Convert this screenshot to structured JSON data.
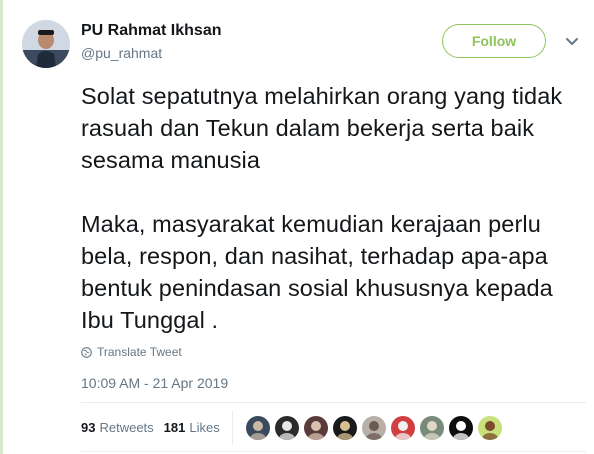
{
  "user": {
    "display_name": "PU Rahmat Ikhsan",
    "handle": "@pu_rahmat"
  },
  "follow_label": "Follow",
  "tweet_text": "Solat sepatutnya melahirkan orang yang tidak rasuah dan Tekun dalam bekerja serta baik sesama manusia\n\nMaka, masyarakat kemudian kerajaan perlu bela, respon, dan nasihat, terhadap apa-apa bentuk penindasan sosial khususnya kepada Ibu Tunggal .",
  "translate_label": "Translate Tweet",
  "timestamp": "10:09 AM - 21 Apr 2019",
  "stats": {
    "retweets_count": "93",
    "retweets_label": "Retweets",
    "likes_count": "181",
    "likes_label": "Likes"
  },
  "colors": {
    "accent": "#8fc45c",
    "muted": "#657786",
    "thread_line": "#d6e8c7"
  },
  "liker_avatars": [
    {
      "bg": "#3a4a5c",
      "fg": "#c9b8a6"
    },
    {
      "bg": "#2b2b2b",
      "fg": "#e8e8e8"
    },
    {
      "bg": "#5a3a3a",
      "fg": "#d9c2b0"
    },
    {
      "bg": "#1a1a1a",
      "fg": "#d8c090"
    },
    {
      "bg": "#b8b0a8",
      "fg": "#6a5a50"
    },
    {
      "bg": "#d04040",
      "fg": "#f0f0f0"
    },
    {
      "bg": "#7a8a7a",
      "fg": "#e0d8c8"
    },
    {
      "bg": "#0d0d0d",
      "fg": "#ffffff"
    },
    {
      "bg": "#c8e07a",
      "fg": "#7a4a2a"
    }
  ]
}
